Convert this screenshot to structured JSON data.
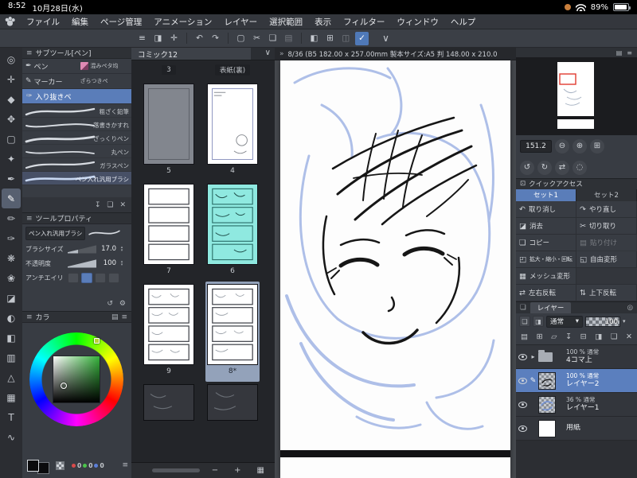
{
  "status_bar": {
    "time": "8:52",
    "date": "10月28日(水)",
    "battery": "89%"
  },
  "menu": {
    "items": [
      "ファイル",
      "編集",
      "ページ管理",
      "アニメーション",
      "レイヤー",
      "選択範囲",
      "表示",
      "フィルター",
      "ウィンドウ",
      "ヘルプ"
    ]
  },
  "toolbar": {
    "icons": [
      {
        "name": "palette-dock",
        "glyph": "≡"
      },
      {
        "name": "modifier-key",
        "glyph": "◨"
      },
      {
        "name": "hand-gesture",
        "glyph": "✛"
      },
      {
        "name": "undo",
        "glyph": "↶"
      },
      {
        "name": "redo",
        "glyph": "↷"
      },
      {
        "name": "deselect",
        "glyph": "▢"
      },
      {
        "name": "cut",
        "glyph": "✂"
      },
      {
        "name": "copy",
        "glyph": "❏"
      },
      {
        "name": "paste",
        "glyph": "▤"
      },
      {
        "name": "fill",
        "glyph": "◧"
      },
      {
        "name": "grid",
        "glyph": "⊞"
      },
      {
        "name": "snap-ruler",
        "glyph": "◫"
      },
      {
        "name": "selection-mode",
        "glyph": "✓"
      },
      {
        "name": "expand-bar",
        "glyph": "∨"
      }
    ]
  },
  "tool_strip": {
    "tools": [
      {
        "name": "zoom",
        "glyph": "◎"
      },
      {
        "name": "move",
        "glyph": "✛"
      },
      {
        "name": "object",
        "glyph": "◆"
      },
      {
        "name": "layer-move",
        "glyph": "✥"
      },
      {
        "name": "selection",
        "glyph": "▢"
      },
      {
        "name": "auto-select",
        "glyph": "✦"
      },
      {
        "name": "eyedropper",
        "glyph": "✒"
      },
      {
        "name": "pen",
        "glyph": "✎"
      },
      {
        "name": "pencil",
        "glyph": "✏"
      },
      {
        "name": "brush",
        "glyph": "✑"
      },
      {
        "name": "airbrush",
        "glyph": "❋"
      },
      {
        "name": "decoration",
        "glyph": "❀"
      },
      {
        "name": "eraser",
        "glyph": "◪"
      },
      {
        "name": "blend",
        "glyph": "◐"
      },
      {
        "name": "fill-bucket",
        "glyph": "◧"
      },
      {
        "name": "gradient",
        "glyph": "▥"
      },
      {
        "name": "figure",
        "glyph": "△"
      },
      {
        "name": "frame-border",
        "glyph": "▦"
      },
      {
        "name": "text",
        "glyph": "T"
      },
      {
        "name": "correct-line",
        "glyph": "∿"
      }
    ]
  },
  "subtool_panel": {
    "menu_icon": "≡",
    "title": "サブツール[ペン]",
    "rows": [
      {
        "icon": "✒",
        "label": "ペン",
        "badge_label": "混みペタ均"
      },
      {
        "icon": "✎",
        "label": "マーカー",
        "badge_label": "ざらつきペ"
      },
      {
        "icon": "✑",
        "label": "入り抜きペ"
      }
    ],
    "brushes": [
      {
        "name": "粗ざく鉛筆"
      },
      {
        "name": "落書きかすれ"
      },
      {
        "name": "ざっくりペン"
      },
      {
        "name": "丸ペン"
      },
      {
        "name": "ガラスペン"
      },
      {
        "name": "ペン入れ汎用ブラシ"
      }
    ],
    "footer": [
      {
        "name": "import",
        "glyph": "↧"
      },
      {
        "name": "duplicate",
        "glyph": "❏"
      },
      {
        "name": "delete",
        "glyph": "✕"
      }
    ]
  },
  "tool_property": {
    "menu_icon": "≡",
    "title": "ツールプロパティ",
    "tool_name": "ペン入れ汎用ブラシ",
    "sliders": [
      {
        "label": "ブラシサイズ",
        "value": "17.0"
      },
      {
        "label": "不透明度",
        "value": "100"
      }
    ],
    "antialias_label": "アンチエイリ",
    "footer": [
      {
        "name": "reset",
        "glyph": "↺"
      },
      {
        "name": "settings",
        "glyph": "⚙"
      }
    ]
  },
  "color_panel": {
    "menu_icon": "≡",
    "title": "カラ",
    "right_icons": [
      {
        "name": "color-set",
        "glyph": "▤"
      },
      {
        "name": "panel-menu",
        "glyph": "≡"
      }
    ],
    "rgb": [
      {
        "color": "#d84b4b",
        "value": "0"
      },
      {
        "color": "#4bc44b",
        "value": "0"
      },
      {
        "color": "#5b7fd8",
        "value": "0"
      }
    ]
  },
  "page_manager": {
    "title": "コミック12",
    "partial_labels": [
      "3",
      "表紙(裏)"
    ],
    "pages": [
      {
        "label": "5"
      },
      {
        "label": "4"
      },
      {
        "label": "7"
      },
      {
        "label": "6"
      },
      {
        "label": "9"
      },
      {
        "label": "8*"
      }
    ],
    "footer": {
      "zoom_out": "−",
      "zoom_in": "+",
      "grid": "▦"
    }
  },
  "canvas": {
    "collapse_icon": "»",
    "title": "8/36 (B5 182.00 x 257.00mm 製本サイズ:A5 判 148.00 x 210.0"
  },
  "navigator": {
    "zoom_value": "151.2",
    "zoom_buttons": [
      {
        "name": "zoom-out",
        "glyph": "⊖"
      },
      {
        "name": "zoom-in",
        "glyph": "⊕"
      },
      {
        "name": "fit-screen",
        "glyph": "⊞"
      }
    ],
    "rotate_buttons": [
      {
        "name": "rotate-left",
        "glyph": "↺"
      },
      {
        "name": "rotate-right",
        "glyph": "↻"
      },
      {
        "name": "flip-horizontal",
        "glyph": "⇄"
      },
      {
        "name": "reset-view",
        "glyph": "◌"
      }
    ]
  },
  "quick_access": {
    "title": "クイックアクセス",
    "tabs": [
      {
        "label": "セット1"
      },
      {
        "label": "セット2"
      }
    ],
    "items": [
      {
        "icon": "↶",
        "label": "取り消し"
      },
      {
        "icon": "↷",
        "label": "やり直し"
      },
      {
        "icon": "◪",
        "label": "消去"
      },
      {
        "icon": "✂",
        "label": "切り取り"
      },
      {
        "icon": "❏",
        "label": "コピー"
      },
      {
        "icon": "▤",
        "label": "貼り付け"
      },
      {
        "icon": "◰",
        "label": "拡大・縮小・回転"
      },
      {
        "icon": "◱",
        "label": "自由変形"
      },
      {
        "icon": "▦",
        "label": "メッシュ変形"
      },
      {
        "icon": "⇄",
        "label": "左右反転"
      },
      {
        "icon": "⇅",
        "label": "上下反転"
      }
    ]
  },
  "layers": {
    "title": "レイヤー",
    "head_icons": [
      {
        "name": "palette-grid",
        "glyph": "❏"
      },
      {
        "name": "search-layer",
        "glyph": "◎"
      }
    ],
    "blend_mode": "通常",
    "opacity": "100",
    "expand_icon": "▸",
    "edit_icon": "✎",
    "tools": [
      {
        "name": "new-raster-layer",
        "gly​ph_unused": "",
        "glyph": "▤"
      },
      {
        "name": "new-vector-layer",
        "glyph": "⊞"
      },
      {
        "name": "new-folder",
        "glyph": "▱"
      },
      {
        "name": "transfer-down",
        "glyph": "↧"
      },
      {
        "name": "merge-down",
        "glyph": "⊟"
      },
      {
        "name": "layer-mask",
        "glyph": "◨"
      },
      {
        "name": "duplicate-layer",
        "glyph": "❏"
      },
      {
        "name": "delete-layer",
        "glyph": "✕"
      }
    ],
    "rows": [
      {
        "info": "100 % 通常",
        "name": "4コマ上"
      },
      {
        "info": "100 % 通常",
        "name": "レイヤー2"
      },
      {
        "info": "36 % 通常",
        "name": "レイヤー1"
      },
      {
        "info": "",
        "name": "用紙"
      }
    ]
  },
  "colors": {
    "accent": "#5a7db9",
    "page_selection": "#93a2ba",
    "page_highlight_cyan": "#8fe9e0",
    "sketch_blue": "#a6b9e6",
    "ink": "#161616"
  }
}
